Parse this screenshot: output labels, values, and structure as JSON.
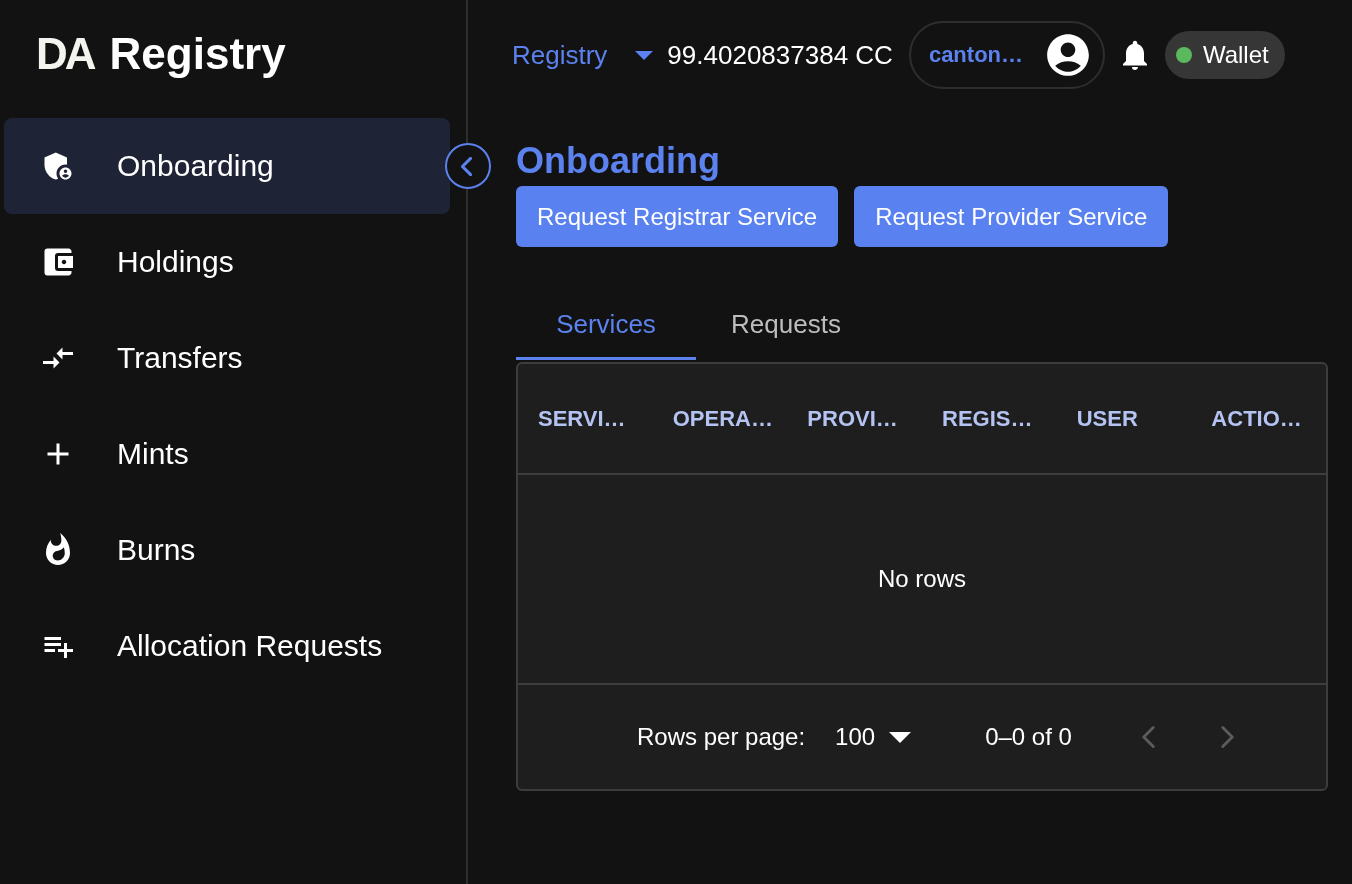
{
  "sidebar": {
    "logo": {
      "mark": "DA",
      "title": "Registry"
    },
    "items": [
      {
        "label": "Onboarding",
        "selected": true
      },
      {
        "label": "Holdings",
        "selected": false
      },
      {
        "label": "Transfers",
        "selected": false
      },
      {
        "label": "Mints",
        "selected": false
      },
      {
        "label": "Burns",
        "selected": false
      },
      {
        "label": "Allocation Requests",
        "selected": false
      }
    ]
  },
  "topbar": {
    "app_menu": "Registry",
    "balance": "99.4020837384 CC",
    "account": "canton…",
    "wallet": {
      "label": "Wallet",
      "connected": true
    }
  },
  "page": {
    "title": "Onboarding",
    "actions": [
      "Request Registrar Service",
      "Request Provider Service"
    ],
    "tabs": [
      {
        "label": "Services",
        "selected": true
      },
      {
        "label": "Requests",
        "selected": false
      }
    ],
    "table": {
      "columns": [
        "SERVI…",
        "OPERA…",
        "PROVI…",
        "REGIS…",
        "USER",
        "ACTIO…"
      ],
      "empty_message": "No rows",
      "pagination": {
        "rows_per_page_label": "Rows per page:",
        "rows_per_page": "100",
        "range": "0–0 of 0",
        "previous_disabled": true,
        "next_disabled": true
      }
    }
  }
}
